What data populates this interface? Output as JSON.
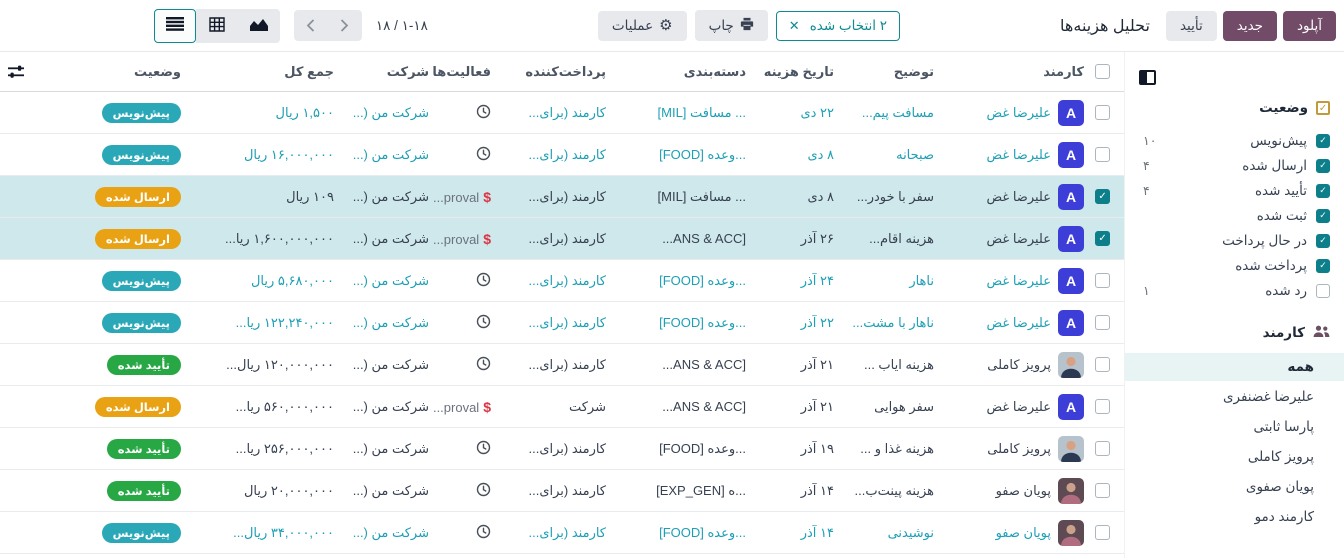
{
  "colors": {
    "purple": "#714B67",
    "teal": "#0E8A93",
    "draft-badge": "#2AA8B8",
    "submitted-badge": "#E8A213",
    "approved-badge": "#28A745",
    "sel-row": "#CEE8EB",
    "draft-text": "#1D9FB5",
    "avatar": "#3D3DD8",
    "danger": "#DC3545"
  },
  "topbar": {
    "title": "تحلیل هزینه‌ها",
    "upload": "آپلود",
    "new": "جدید",
    "approve": "تأیید",
    "selected": "۲ انتخاب شده",
    "close": "✕",
    "print": "چاپ",
    "actions": "عملیات",
    "pager": "۱۸ / ۱-۱۸"
  },
  "table": {
    "headers": {
      "employee": "کارمند",
      "description": "توضیح",
      "date": "تاریخ هزینه",
      "category": "دسته‌بندی",
      "paid_by": "پرداخت‌کننده",
      "activities": "فعالیت‌ها",
      "company": "شرکت",
      "total": "جمع کل",
      "status": "وضعیت"
    },
    "rows": [
      {
        "employee": "علیرضا غض",
        "avatar": "A",
        "desc": "مسافت پیم...",
        "date": "۲۲ دی",
        "category": "[MIL] مسافت ...",
        "paid_by": "کارمند (برای...",
        "activity": "clock",
        "company": "شرکت من (...",
        "total": "۱,۵۰۰ ریال",
        "status": "پیش‌نویس",
        "status_key": "draft",
        "draft": true,
        "selected": false
      },
      {
        "employee": "علیرضا غض",
        "avatar": "A",
        "desc": "صبحانه",
        "date": "۸ دی",
        "category": "[FOOD] وعده...",
        "paid_by": "کارمند (برای...",
        "activity": "clock",
        "company": "شرکت من (...",
        "total": "۱۶,۰۰۰,۰۰۰ ریال",
        "status": "پیش‌نویس",
        "status_key": "draft",
        "draft": true,
        "selected": false
      },
      {
        "employee": "علیرضا غض",
        "avatar": "A",
        "desc": "سفر با خودر...",
        "date": "۸ دی",
        "category": "[MIL] مسافت ...",
        "paid_by": "کارمند (برای...",
        "activity": "approval",
        "activity_text": "...proval",
        "company": "شرکت من (...",
        "total": "۱۰۹ ریال",
        "status": "ارسال شده",
        "status_key": "submitted",
        "draft": false,
        "selected": true
      },
      {
        "employee": "علیرضا غض",
        "avatar": "A",
        "desc": "هزینه اقام...",
        "date": "۲۶ آذر",
        "category": "...ANS & ACC]",
        "paid_by": "کارمند (برای...",
        "activity": "approval",
        "activity_text": "...proval",
        "company": "شرکت من (...",
        "total": "۱,۶۰۰,۰۰۰,۰۰۰ ریا...",
        "status": "ارسال شده",
        "status_key": "submitted",
        "draft": false,
        "selected": true
      },
      {
        "employee": "علیرضا غض",
        "avatar": "A",
        "desc": "ناهار",
        "date": "۲۴ آذر",
        "category": "[FOOD] وعده...",
        "paid_by": "کارمند (برای...",
        "activity": "clock",
        "company": "شرکت من (...",
        "total": "۵,۶۸۰,۰۰۰ ریال",
        "status": "پیش‌نویس",
        "status_key": "draft",
        "draft": true,
        "selected": false
      },
      {
        "employee": "علیرضا غض",
        "avatar": "A",
        "desc": "ناهار با مشت...",
        "date": "۲۲ آذر",
        "category": "[FOOD] وعده...",
        "paid_by": "کارمند (برای...",
        "activity": "clock",
        "company": "شرکت من (...",
        "total": "۱۲۲,۲۴۰,۰۰۰ ریا...",
        "status": "پیش‌نویس",
        "status_key": "draft",
        "draft": true,
        "selected": false
      },
      {
        "employee": "پرویز کاملی",
        "avatar": "photo-suit",
        "desc": "هزینه ایاب ...",
        "date": "۲۱ آذر",
        "category": "...ANS & ACC]",
        "paid_by": "کارمند (برای...",
        "activity": "clock",
        "company": "شرکت من (...",
        "total": "۱۲۰,۰۰۰,۰۰۰ ریال...",
        "status": "تأیید شده",
        "status_key": "approved",
        "draft": false,
        "selected": false
      },
      {
        "employee": "علیرضا غض",
        "avatar": "A",
        "desc": "سفر هوایی",
        "date": "۲۱ آذر",
        "category": "...ANS & ACC]",
        "paid_by": "شرکت",
        "activity": "approval",
        "activity_text": "...proval",
        "company": "شرکت من (...",
        "total": "۵۶۰,۰۰۰,۰۰۰ ریا...",
        "status": "ارسال شده",
        "status_key": "submitted",
        "draft": false,
        "selected": false
      },
      {
        "employee": "پرویز کاملی",
        "avatar": "photo-suit",
        "desc": "هزینه غذا و ...",
        "date": "۱۹ آذر",
        "category": "[FOOD] وعده...",
        "paid_by": "کارمند (برای...",
        "activity": "clock",
        "company": "شرکت من (...",
        "total": "۲۵۶,۰۰۰,۰۰۰ ریا...",
        "status": "تأیید شده",
        "status_key": "approved",
        "draft": false,
        "selected": false
      },
      {
        "employee": "پویان صفو",
        "avatar": "photo-pink",
        "desc": "هزینه پینت‌ب...",
        "date": "۱۴ آذر",
        "category": "[EXP_GEN] ه...",
        "paid_by": "کارمند (برای...",
        "activity": "clock",
        "company": "شرکت من (...",
        "total": "۲۰,۰۰۰,۰۰۰ ریال",
        "status": "تأیید شده",
        "status_key": "approved",
        "draft": false,
        "selected": false
      },
      {
        "employee": "پویان صفو",
        "avatar": "photo-pink",
        "desc": "نوشیدنی",
        "date": "۱۴ آذر",
        "category": "[FOOD] وعده...",
        "paid_by": "کارمند (برای...",
        "activity": "clock",
        "company": "شرکت من (...",
        "total": "۳۴,۰۰۰,۰۰۰ ریال...",
        "status": "پیش‌نویس",
        "status_key": "draft",
        "draft": true,
        "selected": false
      }
    ]
  },
  "sidebar": {
    "status": {
      "title": "وضعیت",
      "items": [
        {
          "label": "پیش‌نویس",
          "checked": true,
          "count": "۱۰"
        },
        {
          "label": "ارسال شده",
          "checked": true,
          "count": "۴"
        },
        {
          "label": "تأیید شده",
          "checked": true,
          "count": "۴"
        },
        {
          "label": "ثبت شده",
          "checked": true,
          "count": ""
        },
        {
          "label": "در حال پرداخت",
          "checked": true,
          "count": ""
        },
        {
          "label": "پرداخت شده",
          "checked": true,
          "count": ""
        },
        {
          "label": "رد شده",
          "checked": false,
          "count": "۱"
        }
      ]
    },
    "employee": {
      "title": "کارمند",
      "items": [
        {
          "label": "همه",
          "active": true
        },
        {
          "label": "علیرضا غضنفری",
          "active": false
        },
        {
          "label": "پارسا ثابتی",
          "active": false
        },
        {
          "label": "پرویز کاملی",
          "active": false
        },
        {
          "label": "پویان صفوی",
          "active": false
        },
        {
          "label": "کارمند دمو",
          "active": false
        }
      ]
    }
  }
}
